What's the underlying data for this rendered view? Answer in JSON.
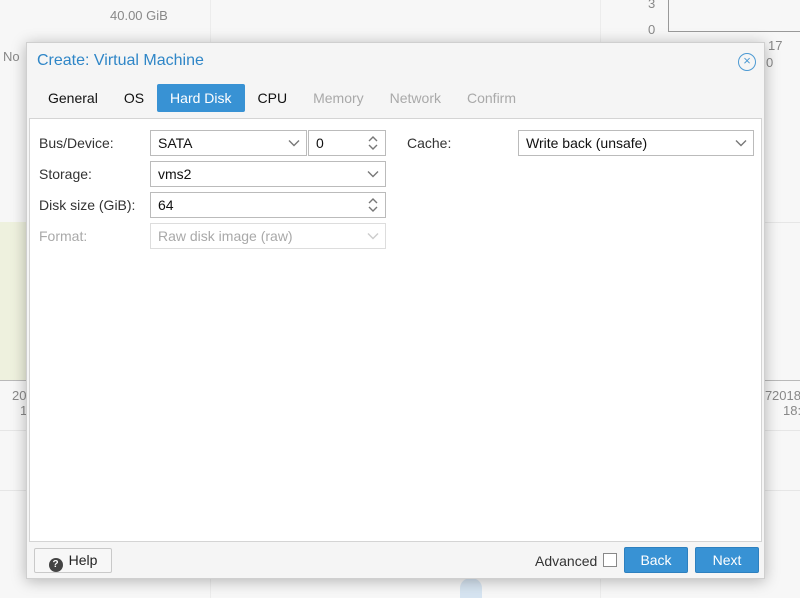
{
  "background": {
    "top_value": "40.00 GiB",
    "left_clip": "No",
    "rchart_tick_top": "3",
    "rchart_tick_zero": "0",
    "rlabel_17": "17",
    "rlabel_0": "0",
    "axis_left_20": "20",
    "axis_left_1": "1",
    "axis_right_7": "7",
    "axis_right_2018": "2018",
    "axis_right_18": "18:"
  },
  "modal": {
    "title": "Create: Virtual Machine",
    "close_symbol": "×",
    "tabs": [
      {
        "label": "General",
        "state": "normal"
      },
      {
        "label": "OS",
        "state": "normal"
      },
      {
        "label": "Hard Disk",
        "state": "active"
      },
      {
        "label": "CPU",
        "state": "normal"
      },
      {
        "label": "Memory",
        "state": "disabled"
      },
      {
        "label": "Network",
        "state": "disabled"
      },
      {
        "label": "Confirm",
        "state": "disabled"
      }
    ],
    "form": {
      "bus_device_label": "Bus/Device:",
      "bus_value": "SATA",
      "device_index": "0",
      "storage_label": "Storage:",
      "storage_value": "vms2",
      "disk_size_label": "Disk size (GiB):",
      "disk_size_value": "64",
      "format_label": "Format:",
      "format_value": "Raw disk image (raw)",
      "cache_label": "Cache:",
      "cache_value": "Write back (unsafe)"
    },
    "footer": {
      "help_label": "Help",
      "help_icon_glyph": "?",
      "advanced_label": "Advanced",
      "advanced_checked": false,
      "back_label": "Back",
      "next_label": "Next"
    }
  },
  "colors": {
    "accent": "#3892d4",
    "title": "#2f86c7",
    "disabled_text": "#a9a9a9"
  }
}
